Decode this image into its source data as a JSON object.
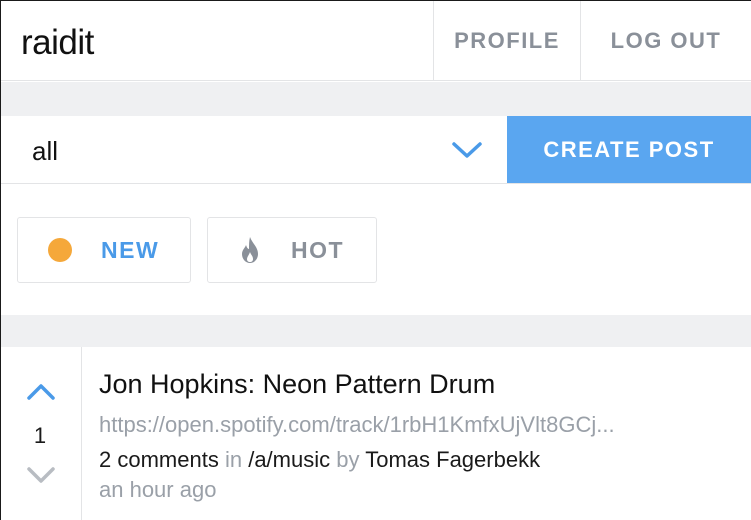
{
  "header": {
    "logo": "raidit",
    "nav": {
      "profile": "PROFILE",
      "logout": "LOG OUT"
    }
  },
  "community_select": {
    "value": "all",
    "icon": "chevron-down-icon"
  },
  "create_post_label": "CREATE POST",
  "sort": {
    "new_label": "NEW",
    "new_icon": "dot-icon",
    "hot_label": "HOT",
    "hot_icon": "flame-icon"
  },
  "colors": {
    "accent": "#5aa6f0",
    "new_dot": "#f5a83a",
    "muted": "#9aa0a8"
  },
  "post": {
    "score": "1",
    "title": "Jon Hopkins: Neon Pattern Drum",
    "url": "https://open.spotify.com/track/1rbH1KmfxUjVlt8GCj...",
    "comments": "2 comments",
    "in_word": "in",
    "community": "/a/music",
    "by_word": "by",
    "author": "Tomas Fagerbekk",
    "time": "an hour ago"
  }
}
